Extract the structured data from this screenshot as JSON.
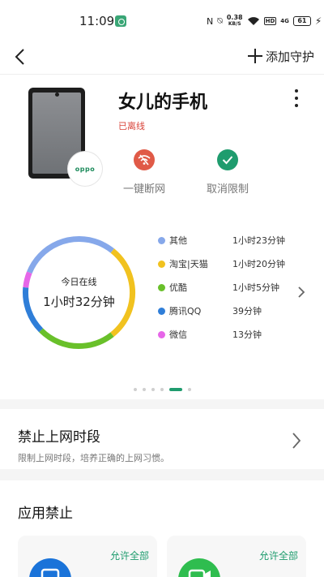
{
  "status_bar": {
    "time": "11:09",
    "speed_value": "0.38",
    "speed_unit": "KB/S",
    "hd": "HD",
    "network": "4G",
    "battery": "61"
  },
  "header": {
    "add_guard_label": "添加守护"
  },
  "device": {
    "name": "女儿的手机",
    "status": "已离线",
    "brand_logo": "oppo",
    "actions": [
      {
        "label": "一键断网",
        "icon": "wifi-off-icon",
        "color": "#e05a47"
      },
      {
        "label": "取消限制",
        "icon": "check-icon",
        "color": "#1f9c6e"
      }
    ]
  },
  "usage": {
    "center_label": "今日在线",
    "center_value": "1小时32分钟",
    "chart_data": {
      "type": "pie",
      "categories": [
        "其他",
        "淘宝|天猫",
        "优酷",
        "腾讯QQ",
        "微信"
      ],
      "values_minutes": [
        83,
        80,
        65,
        39,
        13
      ],
      "labels": [
        "1小时23分钟",
        "1小时20分钟",
        "1小时5分钟",
        "39分钟",
        "13分钟"
      ],
      "colors": [
        "#86a8ea",
        "#f1c21f",
        "#69c02a",
        "#2f7ed8",
        "#e666e8"
      ]
    },
    "pager": {
      "count": 6,
      "active_index": 4
    }
  },
  "time_limit": {
    "title": "禁止上网时段",
    "description": "限制上网时段，培养正确的上网习惯。"
  },
  "app_ban": {
    "title": "应用禁止",
    "cards": [
      {
        "allow_label": "允许全部",
        "icon_color": "#1a73d9"
      },
      {
        "allow_label": "允许全部",
        "icon_color": "#2fbd4f"
      }
    ]
  }
}
